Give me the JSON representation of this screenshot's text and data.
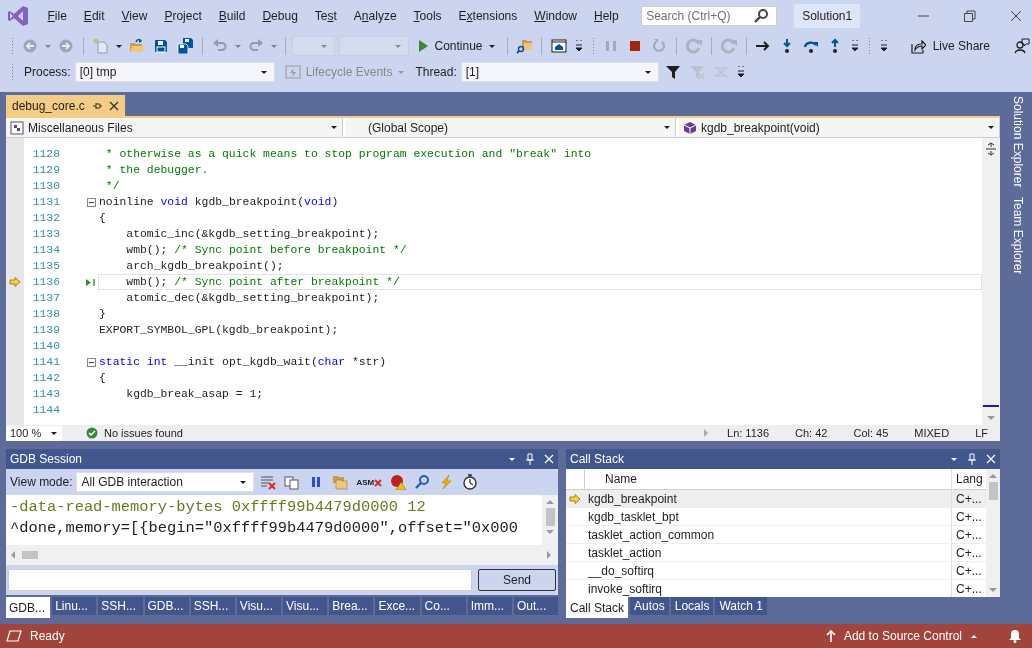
{
  "menu": [
    {
      "key": "F",
      "post": "ile"
    },
    {
      "key": "E",
      "post": "dit"
    },
    {
      "key": "V",
      "post": "iew"
    },
    {
      "key": "P",
      "post": "roject"
    },
    {
      "key": "B",
      "post": "uild"
    },
    {
      "key": "D",
      "post": "ebug"
    },
    {
      "pre": "Te",
      "key": "s",
      "post": "t"
    },
    {
      "pre": "A",
      "key": "n",
      "post": "alyze"
    },
    {
      "key": "T",
      "post": "ools"
    },
    {
      "pre": "E",
      "key": "x",
      "post": "tensions"
    },
    {
      "key": "W",
      "post": "indow"
    },
    {
      "key": "H",
      "post": "elp"
    }
  ],
  "search": {
    "placeholder": "Search (Ctrl+Q)"
  },
  "solution": "Solution1",
  "toolbar": [
    {
      "kind": "grip"
    },
    {
      "kind": "back",
      "disabled": true
    },
    {
      "kind": "caret",
      "disabled": true
    },
    {
      "kind": "forward",
      "disabled": true
    },
    {
      "kind": "sep"
    },
    {
      "kind": "new-item",
      "disabled": true
    },
    {
      "kind": "caret",
      "disabled": false
    },
    {
      "kind": "open",
      "disabled": false
    },
    {
      "kind": "save",
      "disabled": false
    },
    {
      "kind": "save-all",
      "disabled": false
    },
    {
      "kind": "sep"
    },
    {
      "kind": "undo",
      "disabled": true
    },
    {
      "kind": "caret",
      "disabled": true
    },
    {
      "kind": "redo",
      "disabled": true
    },
    {
      "kind": "caret",
      "disabled": true
    },
    {
      "kind": "sep"
    },
    {
      "kind": "combo",
      "disabled": true
    },
    {
      "kind": "combo-wide",
      "disabled": true
    },
    {
      "kind": "continue",
      "label": "Continue",
      "disabled": false
    },
    {
      "kind": "sep"
    },
    {
      "kind": "folder-search",
      "disabled": false
    },
    {
      "kind": "sep"
    },
    {
      "kind": "home-window",
      "disabled": false
    },
    {
      "kind": "overflow",
      "disabled": false
    },
    {
      "kind": "grip"
    },
    {
      "kind": "pause",
      "disabled": true
    },
    {
      "kind": "stop",
      "disabled": false
    },
    {
      "kind": "restart",
      "disabled": true
    },
    {
      "kind": "sep"
    },
    {
      "kind": "refresh",
      "disabled": true
    },
    {
      "kind": "sep"
    },
    {
      "kind": "refresh",
      "disabled": true
    },
    {
      "kind": "sep"
    },
    {
      "kind": "arrow-right",
      "disabled": false
    },
    {
      "kind": "step-into",
      "disabled": false
    },
    {
      "kind": "step-over",
      "disabled": false
    },
    {
      "kind": "step-out",
      "disabled": false
    },
    {
      "kind": "overflow",
      "disabled": false
    },
    {
      "kind": "grip"
    },
    {
      "kind": "overflow",
      "disabled": false
    },
    {
      "kind": "live-share",
      "label": "Live Share",
      "disabled": false
    },
    {
      "kind": "feedback",
      "disabled": false
    }
  ],
  "process_bar": {
    "process_label": "Process:",
    "process": "[0] tmp",
    "lifecycle": {
      "label": "Lifecycle Events",
      "disabled": true
    },
    "thread_label": "Thread:",
    "thread": "[1]",
    "icons": [
      {
        "kind": "filter",
        "disabled": false
      },
      {
        "kind": "filter-x",
        "disabled": true
      },
      {
        "kind": "flag-x",
        "disabled": true
      },
      {
        "kind": "overflow",
        "disabled": false
      }
    ]
  },
  "document_tab": {
    "title": "debug_core.c",
    "selected": true
  },
  "navigation": [
    "Miscellaneous Files",
    "(Global Scope)",
    "kgdb_breakpoint(void)"
  ],
  "code": [
    {
      "number": "1128",
      "segments": [
        {
          "kind": "comment",
          "text": " * otherwise as a quick means to stop program execution and \"break\" into"
        }
      ]
    },
    {
      "number": "1129",
      "segments": [
        {
          "kind": "comment",
          "text": " * the debugger."
        }
      ]
    },
    {
      "number": "1130",
      "segments": [
        {
          "kind": "comment",
          "text": " */"
        }
      ]
    },
    {
      "number": "1131",
      "fold": true,
      "segments": [
        {
          "kind": "code",
          "text": "noinline "
        },
        {
          "kind": "keyword",
          "text": "void"
        },
        {
          "kind": "code",
          "text": " kgdb_breakpoint("
        },
        {
          "kind": "keyword",
          "text": "void"
        },
        {
          "kind": "code",
          "text": ")"
        }
      ]
    },
    {
      "number": "1132",
      "segments": [
        {
          "kind": "code",
          "text": "{"
        }
      ]
    },
    {
      "number": "1133",
      "segments": [
        {
          "kind": "code",
          "text": "    atomic_inc(&kgdb_setting_breakpoint);"
        }
      ]
    },
    {
      "number": "1134",
      "segments": [
        {
          "kind": "code",
          "text": "    wmb(); "
        },
        {
          "kind": "comment",
          "text": "/* Sync point before breakpoint */"
        }
      ]
    },
    {
      "number": "1135",
      "segments": [
        {
          "kind": "code",
          "text": "    arch_kgdb_breakpoint();"
        }
      ]
    },
    {
      "number": "1136",
      "current": true,
      "segments": [
        {
          "kind": "code",
          "text": "    wmb(); "
        },
        {
          "kind": "comment",
          "text": "/* Sync point after breakpoint */"
        }
      ]
    },
    {
      "number": "1137",
      "segments": [
        {
          "kind": "code",
          "text": "    atomic_dec(&kgdb_setting_breakpoint);"
        }
      ]
    },
    {
      "number": "1138",
      "segments": [
        {
          "kind": "code",
          "text": "}"
        }
      ]
    },
    {
      "number": "1139",
      "segments": [
        {
          "kind": "code",
          "text": "EXPORT_SYMBOL_GPL(kgdb_breakpoint);"
        }
      ]
    },
    {
      "number": "1140"
    },
    {
      "number": "1141",
      "fold": true,
      "segments": [
        {
          "kind": "keyword",
          "text": "static int"
        },
        {
          "kind": "code",
          "text": " __init opt_kgdb_wait("
        },
        {
          "kind": "keyword",
          "text": "char"
        },
        {
          "kind": "code",
          "text": " *str)"
        }
      ]
    },
    {
      "number": "1142",
      "segments": [
        {
          "kind": "code",
          "text": "{"
        }
      ]
    },
    {
      "number": "1143",
      "segments": [
        {
          "kind": "code",
          "text": "    kgdb_break_asap = 1;"
        }
      ]
    },
    {
      "number": "1144"
    }
  ],
  "editor_status": {
    "zoom": "100 %",
    "issues": "No issues found",
    "ln": "Ln: 1136",
    "ch": "Ch: 42",
    "col": "Col: 45",
    "encoding": "MIXED",
    "eol": "LF"
  },
  "side_tabs": [
    "Solution Explorer",
    "Team Explorer"
  ],
  "gdb": {
    "title": "GDB Session",
    "view_mode_label": "View mode:",
    "view_mode": "All GDB interaction",
    "tools": [
      {
        "kind": "clear"
      },
      {
        "kind": "copy"
      },
      {
        "kind": "pause-blue"
      },
      {
        "kind": "folders"
      },
      {
        "kind": "asm",
        "label": "ASM"
      },
      {
        "kind": "break-warn"
      },
      {
        "kind": "find"
      },
      {
        "kind": "lightning"
      },
      {
        "kind": "stopwatch"
      }
    ],
    "output": [
      {
        "kind": "command",
        "text": "-data-read-memory-bytes 0xffff99b4479d0000 12"
      },
      {
        "kind": "response",
        "text": "^done,memory=[{begin=\"0xffff99b4479d0000\",offset=\"0x000"
      }
    ],
    "send": "Send",
    "tabs": [
      {
        "label": "GDB...",
        "selected": true
      },
      {
        "label": "Linu...",
        "selected": false
      },
      {
        "label": "SSH...",
        "selected": false
      },
      {
        "label": "GDB...",
        "selected": false
      },
      {
        "label": "SSH...",
        "selected": false
      },
      {
        "label": "Visu...",
        "selected": false
      },
      {
        "label": "Visu...",
        "selected": false
      },
      {
        "label": "Brea...",
        "selected": false
      },
      {
        "label": "Exce...",
        "selected": false
      },
      {
        "label": "Co...",
        "selected": false
      },
      {
        "label": "Imm...",
        "selected": false
      },
      {
        "label": "Out...",
        "selected": false
      }
    ]
  },
  "call_stack": {
    "title": "Call Stack",
    "columns": [
      "Name",
      "Lang"
    ],
    "rows": [
      {
        "name": "kgdb_breakpoint",
        "lang": "C+...",
        "current": true,
        "selected": true
      },
      {
        "name": "kgdb_tasklet_bpt",
        "lang": "C+...",
        "current": false,
        "selected": false
      },
      {
        "name": "tasklet_action_common",
        "lang": "C+...",
        "current": false,
        "selected": false
      },
      {
        "name": "tasklet_action",
        "lang": "C+...",
        "current": false,
        "selected": false
      },
      {
        "name": "__do_softirq",
        "lang": "C+...",
        "current": false,
        "selected": false
      },
      {
        "name": "invoke_softirq",
        "lang": "C+...",
        "current": false,
        "selected": false
      }
    ],
    "tabs": [
      {
        "label": "Call Stack",
        "selected": true
      },
      {
        "label": "Autos",
        "selected": false
      },
      {
        "label": "Locals",
        "selected": false
      },
      {
        "label": "Watch 1",
        "selected": false
      }
    ]
  },
  "status_bar": {
    "text": "Ready",
    "source_control": "Add to Source Control"
  }
}
